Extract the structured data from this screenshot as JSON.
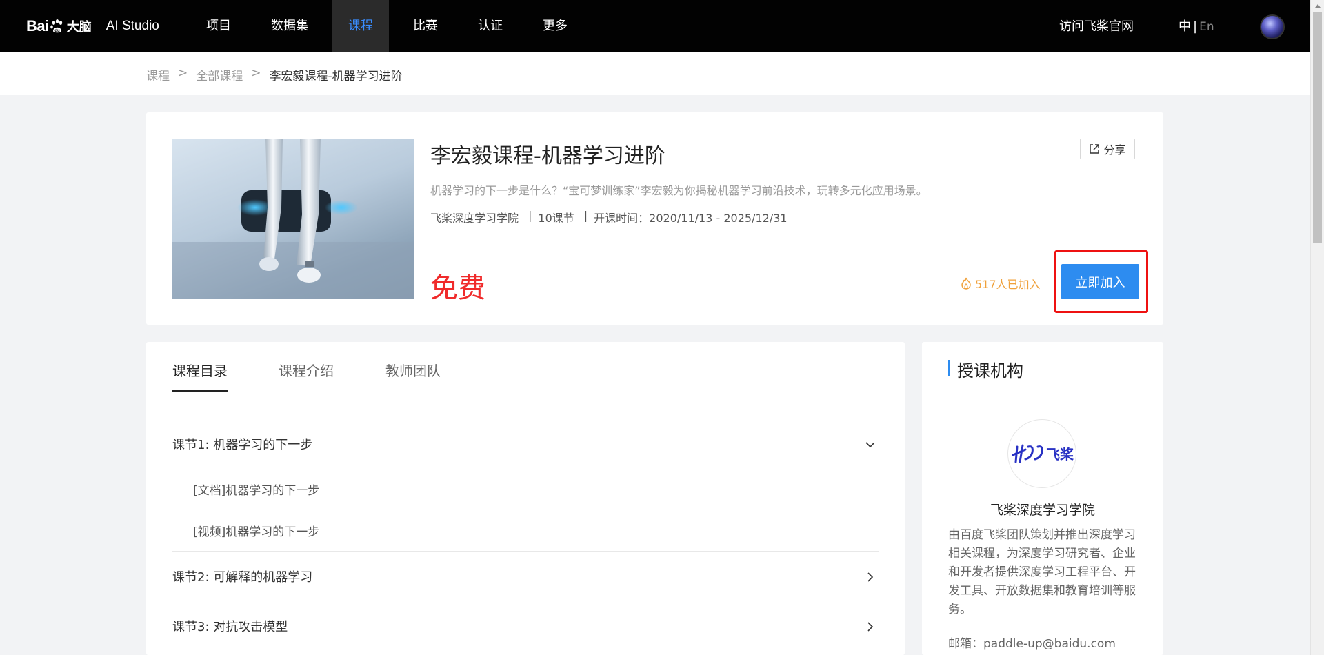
{
  "topnav": {
    "logo_bai": "Bai",
    "logo_du": "大脑",
    "logo_studio": "AI Studio",
    "items": [
      {
        "label": "项目",
        "active": false
      },
      {
        "label": "数据集",
        "active": false
      },
      {
        "label": "课程",
        "active": true
      },
      {
        "label": "比赛",
        "active": false
      },
      {
        "label": "认证",
        "active": false
      },
      {
        "label": "更多",
        "active": false
      }
    ],
    "visit_label": "访问飞桨官网",
    "lang_zh": "中",
    "lang_sep": "|",
    "lang_en": "En"
  },
  "breadcrumb": {
    "items": [
      "课程",
      "全部课程"
    ],
    "separator": ">",
    "current": "李宏毅课程-机器学习进阶"
  },
  "course": {
    "title": "李宏毅课程-机器学习进阶",
    "share_label": "分享",
    "description": "机器学习的下一步是什么？“宝可梦训练家”李宏毅为你揭秘机器学习前沿技术，玩转多元化应用场景。",
    "institution": "飞桨深度学习学院",
    "meta_sep": "|",
    "lessons_count": "10课节",
    "period": "开课时间：2020/11/13 - 2025/12/31",
    "price": "免费",
    "joined": "517人已加入",
    "join_label": "立即加入"
  },
  "tabs": {
    "items": [
      "课程目录",
      "课程介绍",
      "教师团队"
    ]
  },
  "lessons": [
    {
      "title": "课节1: 机器学习的下一步",
      "expanded": true,
      "items": [
        "[文档]机器学习的下一步",
        "[视频]机器学习的下一步"
      ]
    },
    {
      "title": "课节2: 可解释的机器学习",
      "expanded": false
    },
    {
      "title": "课节3: 对抗攻击模型",
      "expanded": false
    }
  ],
  "org": {
    "heading": "授课机构",
    "logo_text": "飞桨",
    "name": "飞桨深度学习学院",
    "description": "由百度飞桨团队策划并推出深度学习相关课程，为深度学习研究者、企业和开发者提供深度学习工程平台、开发工具、开放数据集和教育培训等服务。",
    "email": "邮箱：paddle-up@baidu.com"
  },
  "colors": {
    "accent": "#2d8cf0",
    "price": "#f02b2b",
    "joined": "#f0a13b",
    "highlight_box": "#ee1111"
  }
}
